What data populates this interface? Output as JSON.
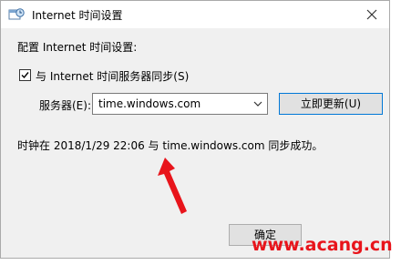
{
  "window": {
    "title": "Internet 时间设置",
    "close_icon": "close-icon"
  },
  "section": {
    "label": "配置 Internet 时间设置:"
  },
  "sync": {
    "checked": true,
    "label": "与 Internet 时间服务器同步(S)"
  },
  "server": {
    "label": "服务器(E):",
    "value": "time.windows.com",
    "update_button": "立即更新(U)"
  },
  "status": {
    "text": "时钟在 2018/1/29 22:06 与 time.windows.com 同步成功。"
  },
  "footer": {
    "ok_button": "确定"
  },
  "watermark": {
    "text": "www.acang.cn"
  },
  "colors": {
    "arrow": "#e8141b",
    "focus_border": "#0078d7"
  }
}
